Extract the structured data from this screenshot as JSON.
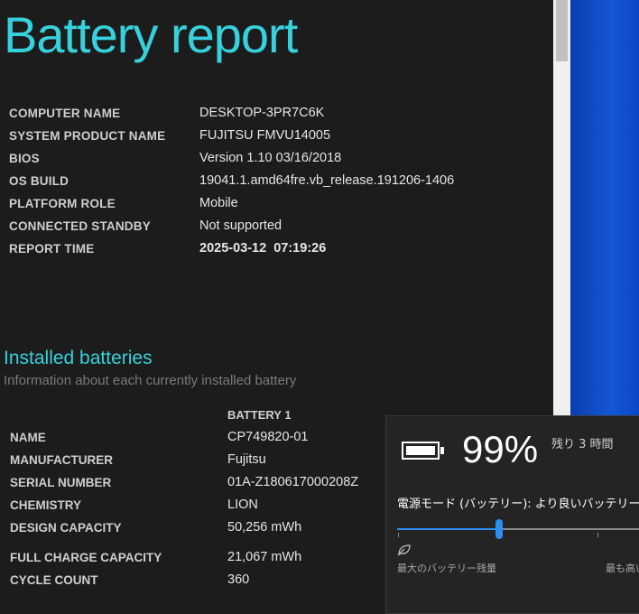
{
  "report": {
    "title": "Battery report",
    "info": [
      {
        "label": "COMPUTER NAME",
        "value": "DESKTOP-3PR7C6K"
      },
      {
        "label": "SYSTEM PRODUCT NAME",
        "value": "FUJITSU FMVU14005"
      },
      {
        "label": "BIOS",
        "value": "Version 1.10 03/16/2018"
      },
      {
        "label": "OS BUILD",
        "value": "19041.1.amd64fre.vb_release.191206-1406"
      },
      {
        "label": "PLATFORM ROLE",
        "value": "Mobile"
      },
      {
        "label": "CONNECTED STANDBY",
        "value": "Not supported"
      },
      {
        "label": "REPORT TIME",
        "value": "2025-03-12  07:19:26"
      }
    ],
    "installed": {
      "heading": "Installed batteries",
      "subtitle": "Information about each currently installed battery",
      "column": "BATTERY 1",
      "rows": [
        {
          "label": "NAME",
          "value": "CP749820-01"
        },
        {
          "label": "MANUFACTURER",
          "value": "Fujitsu"
        },
        {
          "label": "SERIAL NUMBER",
          "value": "01A-Z180617000208Z"
        },
        {
          "label": "CHEMISTRY",
          "value": "LION"
        },
        {
          "label": "DESIGN CAPACITY",
          "value": "50,256 mWh"
        },
        {
          "label": "FULL CHARGE CAPACITY",
          "value": "21,067 mWh"
        },
        {
          "label": "CYCLE COUNT",
          "value": "360"
        }
      ]
    }
  },
  "flyout": {
    "percent": "99%",
    "remaining": "残り 3 時間",
    "mode": "電源モード (バッテリー): より良いバッテリー",
    "slider_value_fraction": 0.42,
    "left_label": "最大のバッテリー残量",
    "right_label": "最も高い",
    "icons": [
      "battery-icon",
      "leaf-icon"
    ],
    "accent": "#2b8ef0"
  },
  "colors": {
    "title": "#36d1dc",
    "background": "#1c1c1c"
  }
}
